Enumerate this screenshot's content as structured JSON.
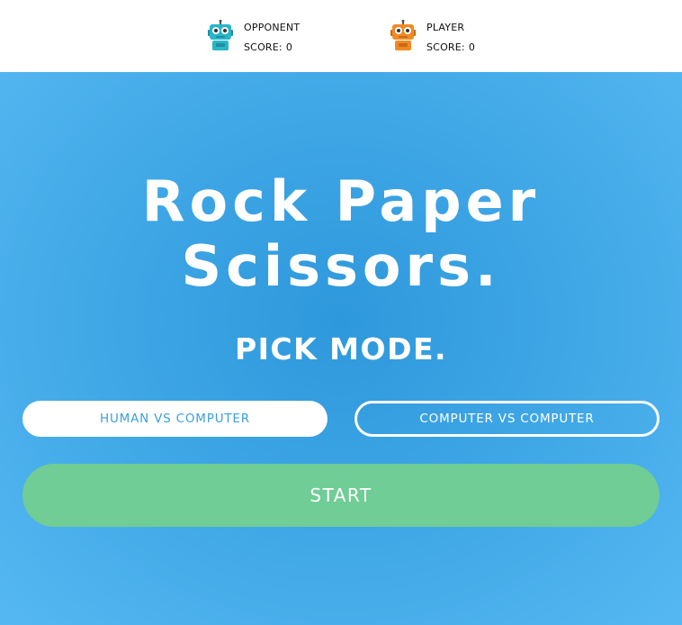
{
  "header": {
    "opponent": {
      "label": "OPPONENT",
      "score_label": "SCORE:",
      "score": "0",
      "avatar_color": "#29b6c9",
      "avatar_icon": "robot-icon"
    },
    "player": {
      "label": "PLAYER",
      "score_label": "SCORE:",
      "score": "0",
      "avatar_color": "#f08a24",
      "avatar_icon": "robot-icon"
    }
  },
  "main": {
    "title_line1": "Rock Paper",
    "title_line2": "Scissors.",
    "pick_mode": "PICK MODE."
  },
  "modes": {
    "human_vs_computer": "HUMAN VS COMPUTER",
    "computer_vs_computer": "COMPUTER VS COMPUTER"
  },
  "start_button": "START",
  "colors": {
    "background": "#3ea6e5",
    "start_button": "#6fcd95",
    "mode_text": "#3d9fdc"
  }
}
